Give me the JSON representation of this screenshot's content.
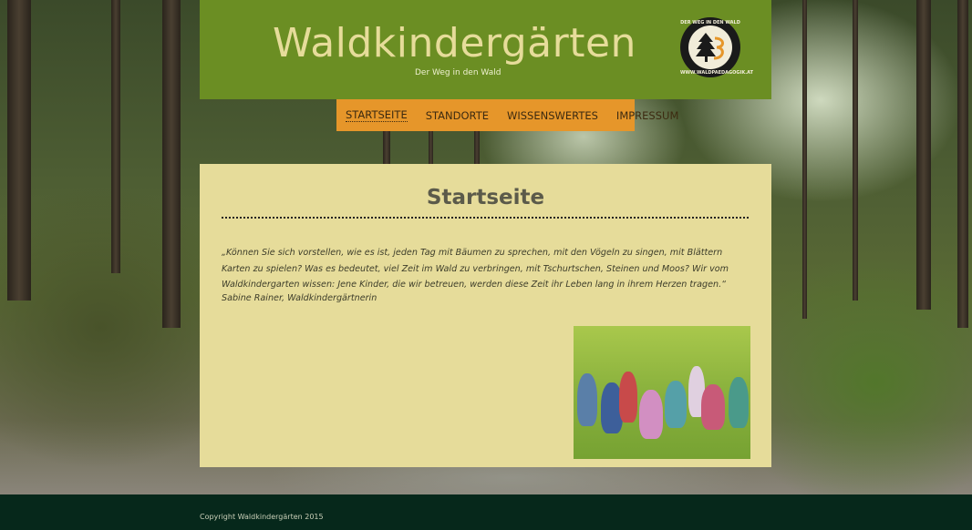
{
  "header": {
    "title": "Waldkindergärten",
    "subtitle": "Der Weg in den Wald",
    "logo": {
      "top_text": "DER WEG IN DEN WALD",
      "bottom_text": "WWW.WALDPAEDAGOGIK.AT"
    }
  },
  "nav": {
    "items": [
      {
        "label": "STARTSEITE",
        "active": true
      },
      {
        "label": "STANDORTE"
      },
      {
        "label": "WISSENSWERTES"
      },
      {
        "label": "IMPRESSUM"
      }
    ]
  },
  "main": {
    "page_title": "Startseite",
    "quote": "„Können Sie sich vorstellen, wie es ist, jeden Tag mit Bäumen zu sprechen, mit den Vögeln zu singen, mit Blättern Karten zu spielen? Was es bedeutet, viel Zeit im Wald zu verbringen, mit Tschurtschen, Steinen und Moos? Wir vom Waldkindergarten wissen: Jene Kinder, die wir betreuen, werden diese Zeit ihr Leben lang in ihrem Herzen tragen.“",
    "author": "Sabine Rainer, Waldkindergärtnerin"
  },
  "footer": {
    "copyright": "Copyright Waldkindergärten 2015"
  },
  "colors": {
    "header_bg": "#6b8e23",
    "nav_bg": "#e6962a",
    "content_bg": "#e6dc9a",
    "footer_bg": "#06281b",
    "title_text": "#e6dc9a"
  }
}
